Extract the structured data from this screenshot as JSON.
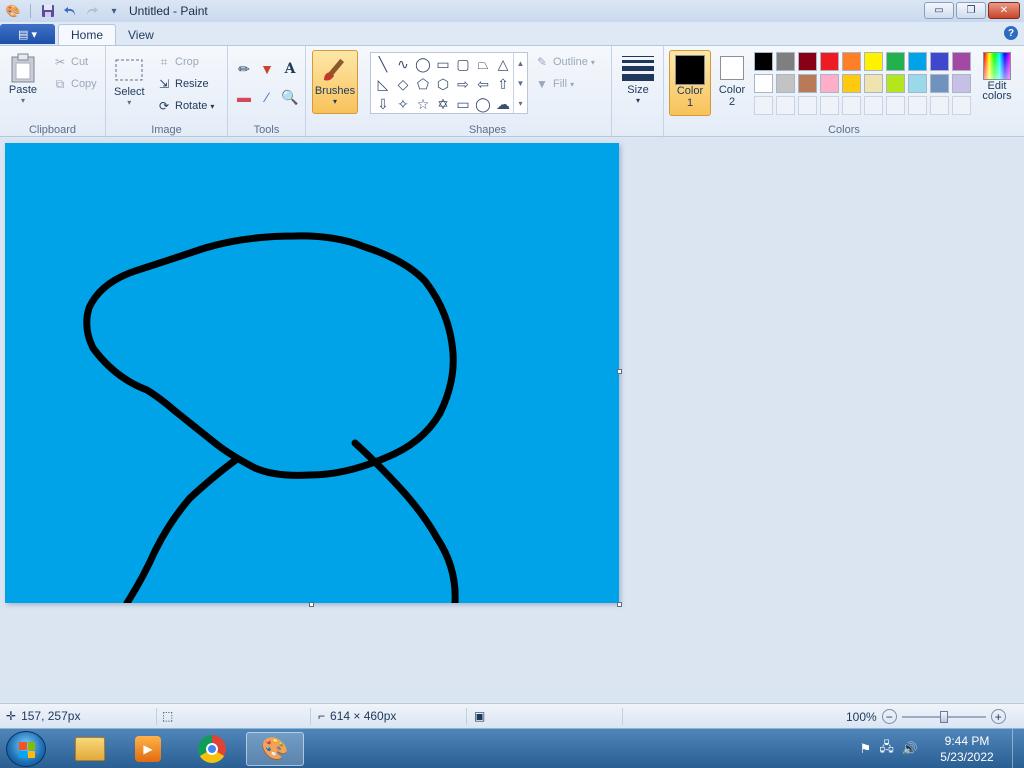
{
  "window": {
    "title": "Untitled - Paint",
    "minimize": "▭",
    "maximize": "❐",
    "close": "✕"
  },
  "tabs": {
    "app_menu": "▤ ▾",
    "home": "Home",
    "view": "View",
    "help": "?"
  },
  "clipboard": {
    "paste": "Paste",
    "cut": "Cut",
    "copy": "Copy",
    "label": "Clipboard"
  },
  "image": {
    "select": "Select",
    "crop": "Crop",
    "resize": "Resize",
    "rotate": "Rotate",
    "label": "Image"
  },
  "tools": {
    "label": "Tools",
    "text_glyph": "A"
  },
  "brushes": {
    "label": "Brushes"
  },
  "shapes": {
    "outline": "Outline",
    "fill": "Fill",
    "label": "Shapes"
  },
  "size": {
    "label": "Size"
  },
  "colors": {
    "color1_label": "Color",
    "color1_num": "1",
    "color2_label": "Color",
    "color2_num": "2",
    "edit_label": "Edit",
    "edit_label2": "colors",
    "label": "Colors",
    "color1_value": "#000000",
    "color2_value": "#ffffff",
    "palette_row1": [
      "#000000",
      "#7f7f7f",
      "#880015",
      "#ed1c24",
      "#ff7f27",
      "#fff200",
      "#22b14c",
      "#00a2e8",
      "#3f48cc",
      "#a349a4"
    ],
    "palette_row2": [
      "#ffffff",
      "#c3c3c3",
      "#b97a57",
      "#ffaec9",
      "#ffc90e",
      "#efe4b0",
      "#b5e61d",
      "#99d9ea",
      "#7092be",
      "#c8bfe7"
    ]
  },
  "canvas": {
    "background": "#00a2e8",
    "stroke_color": "#000000"
  },
  "status": {
    "cursor_pos": "157, 257px",
    "image_size": "614 × 460px",
    "zoom": "100%"
  },
  "taskbar": {
    "time": "9:44 PM",
    "date": "5/23/2022"
  }
}
